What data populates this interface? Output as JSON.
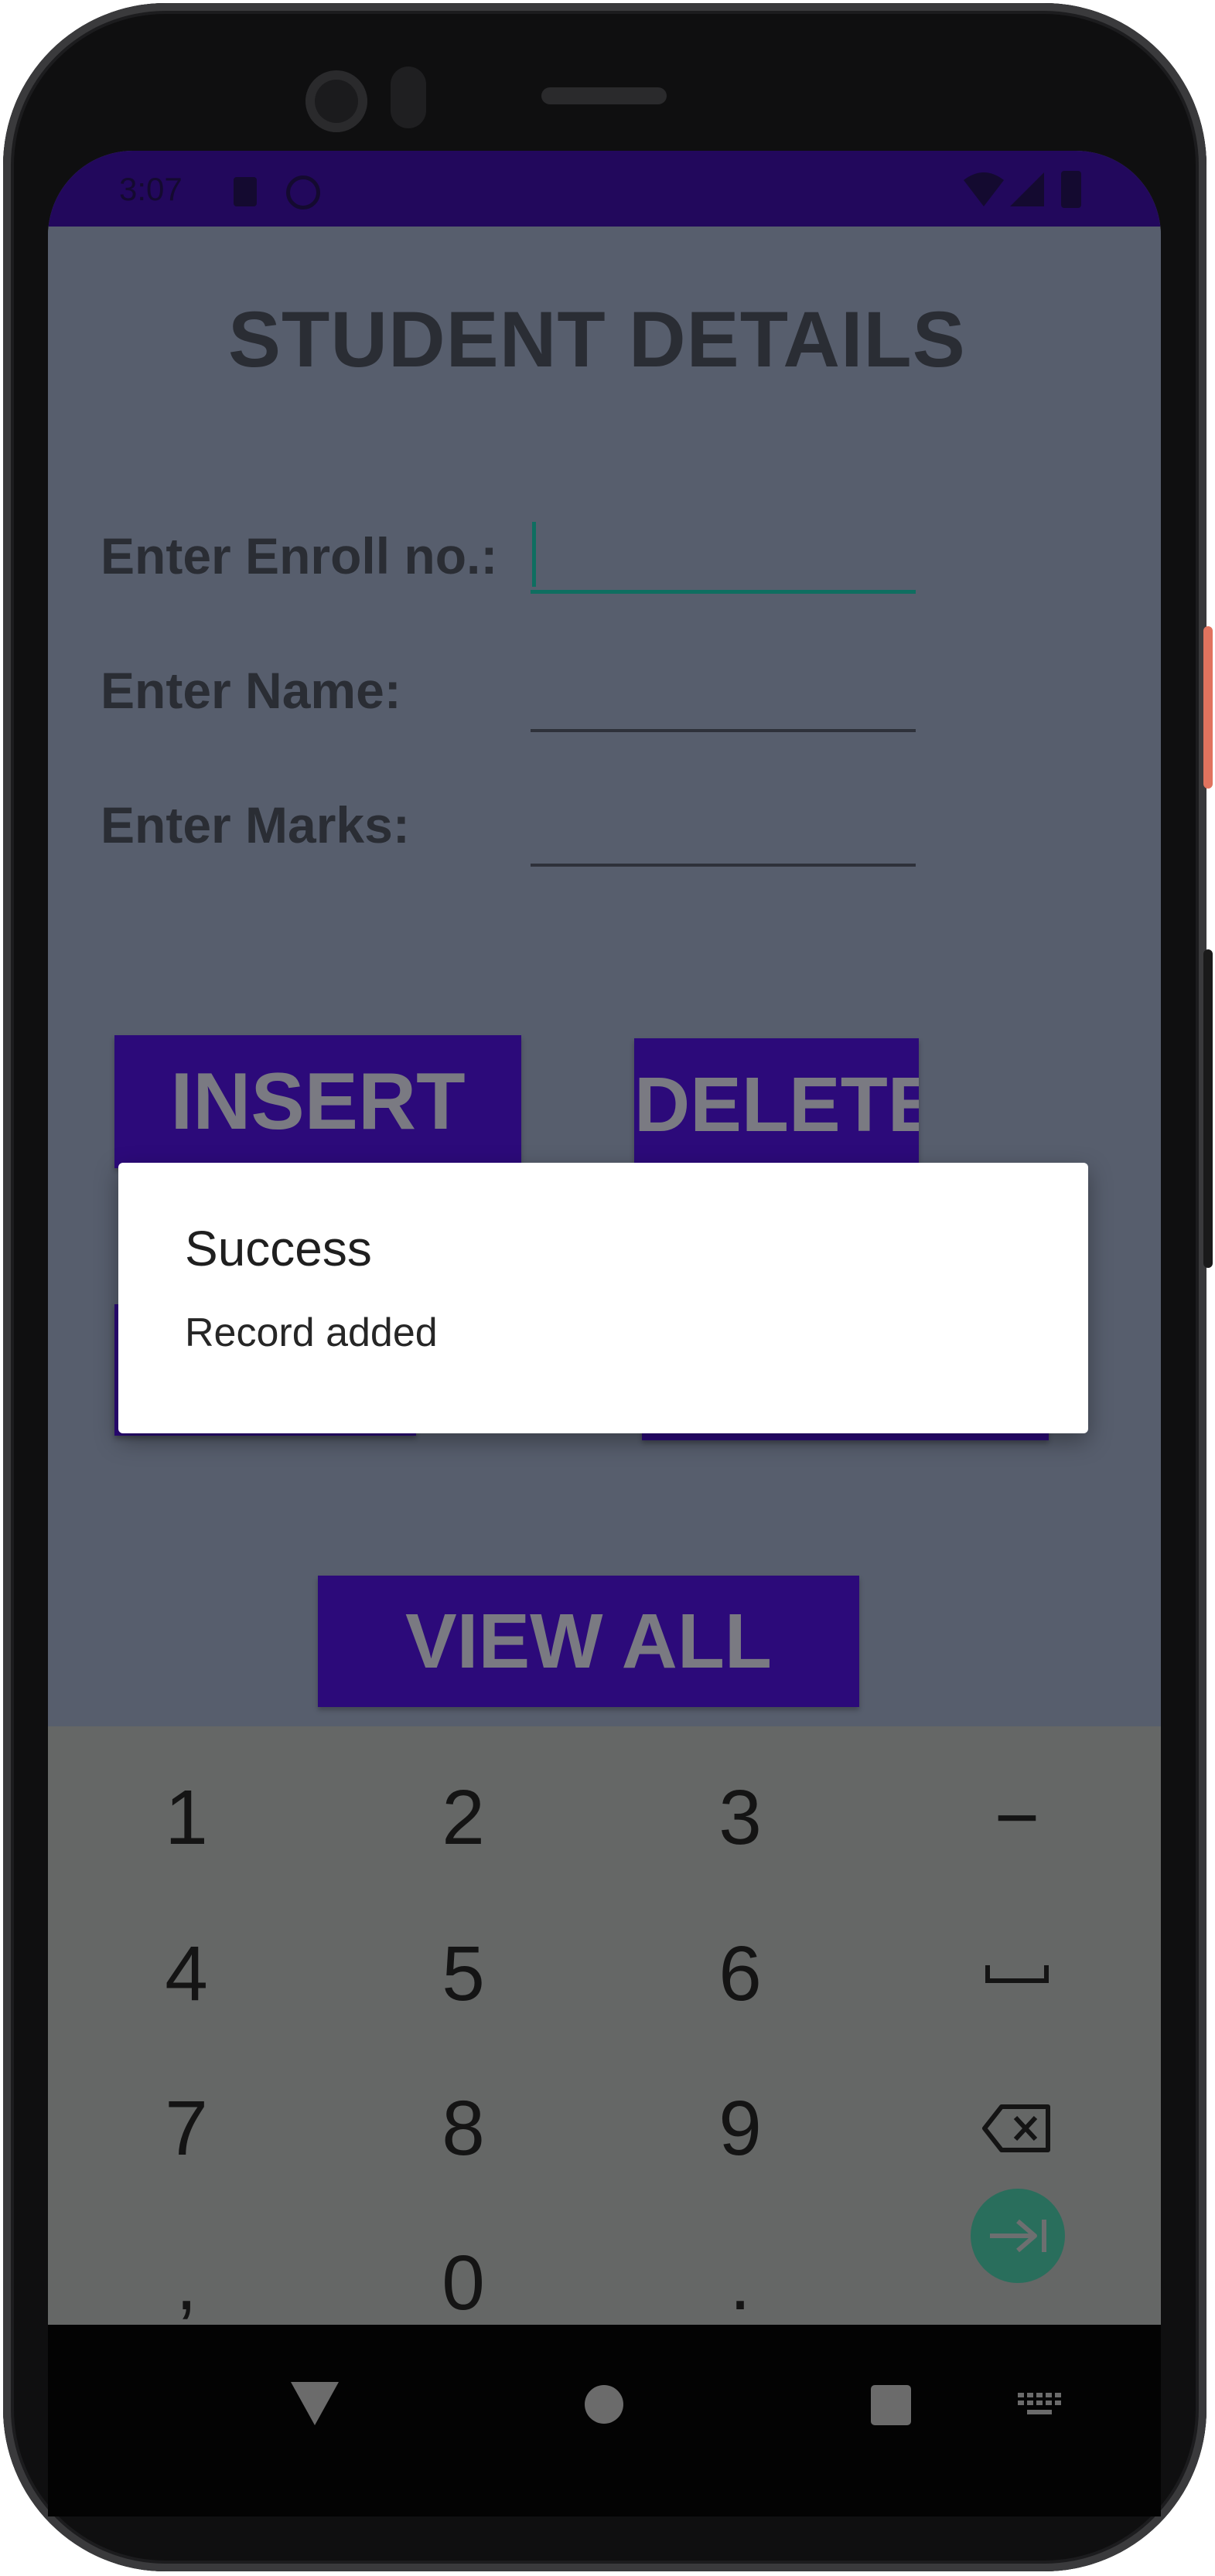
{
  "status_bar": {
    "time": "3:07"
  },
  "app": {
    "title": "STUDENT DETAILS",
    "fields": [
      {
        "label": "Enter Enroll no.:",
        "value": ""
      },
      {
        "label": "Enter Name:",
        "value": ""
      },
      {
        "label": "Enter Marks:",
        "value": ""
      }
    ],
    "buttons": {
      "insert": "INSERT",
      "delete": "DELETE",
      "view_all": "VIEW ALL"
    }
  },
  "dialog": {
    "title": "Success",
    "message": "Record added"
  },
  "keyboard": {
    "rows": [
      [
        "1",
        "2",
        "3",
        "−"
      ],
      [
        "4",
        "5",
        "6",
        "space-icon"
      ],
      [
        "7",
        "8",
        "9",
        "backspace-icon"
      ],
      [
        ",",
        "0",
        ".",
        "next-icon"
      ]
    ]
  },
  "colors": {
    "accent": "#2c0a7a",
    "field_focus": "#0f6e60",
    "scrim_app": "#575e6d",
    "keyboard_bg": "#656766",
    "fab": "#296e5c"
  },
  "nav_icons": [
    "back-icon",
    "home-icon",
    "recents-icon",
    "keyboard-switch-icon"
  ]
}
